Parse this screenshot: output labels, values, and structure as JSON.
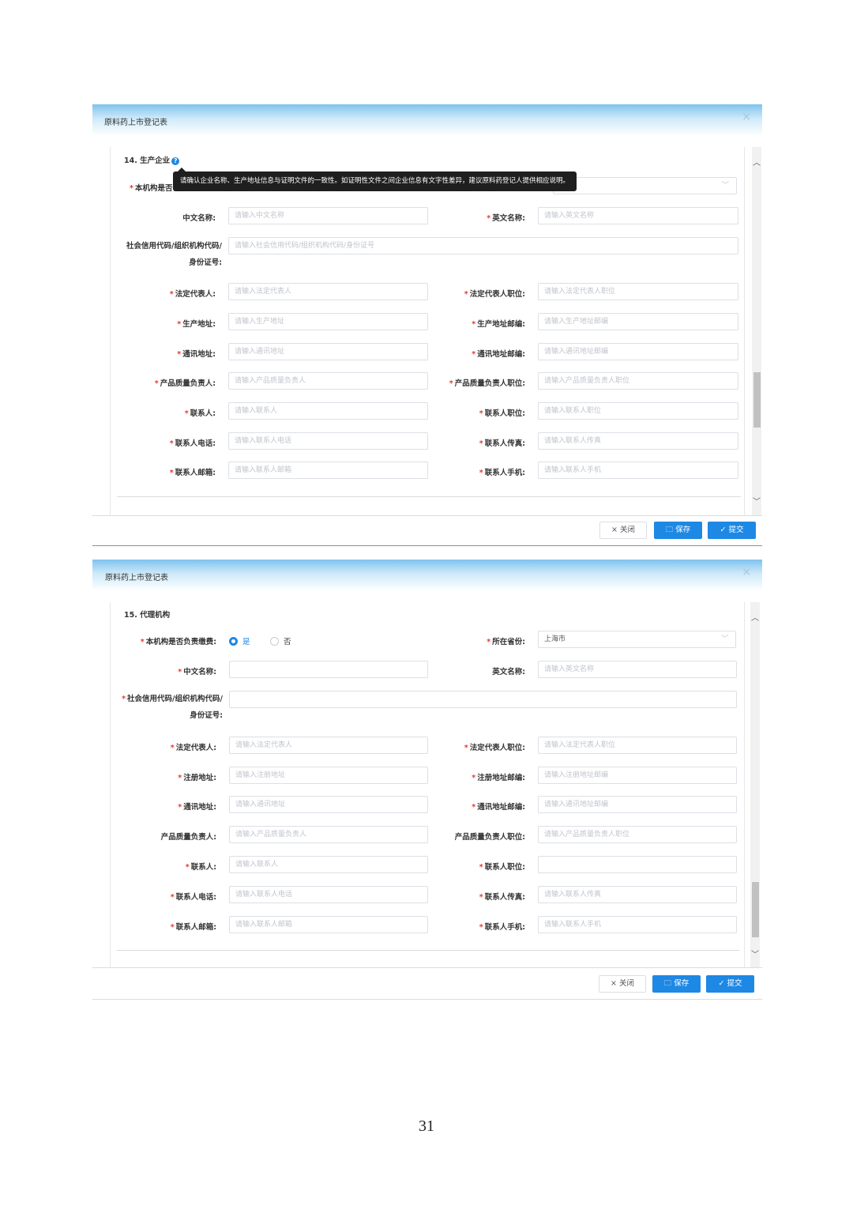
{
  "dialog1": {
    "title": "原料药上市登记表",
    "close": "×",
    "section": "14. 生产企业",
    "help": "?",
    "tooltip": "请确认企业名称、生产地址信息与证明文件的一致性。如证明性文件之间企业信息有文字性差异，建议原料药登记人提供相应说明。",
    "hidden_label": "本机构是否",
    "fields": {
      "cn_name_label": "中文名称:",
      "cn_name_ph": "请输入中文名称",
      "en_name_label": "英文名称:",
      "en_name_ph": "请输入英文名称",
      "credit_label": "社会信用代码/组织机构代码/身份证号:",
      "credit_ph": "请输入社会信用代码/组织机构代码/身份证号",
      "legal_label": "法定代表人:",
      "legal_ph": "请输入法定代表人",
      "legal_pos_label": "法定代表人职位:",
      "legal_pos_ph": "请输入法定代表人职位",
      "prod_addr_label": "生产地址:",
      "prod_addr_ph": "请输入生产地址",
      "prod_zip_label": "生产地址邮编:",
      "prod_zip_ph": "请输入生产地址邮编",
      "mail_addr_label": "通讯地址:",
      "mail_addr_ph": "请输入通讯地址",
      "mail_zip_label": "通讯地址邮编:",
      "mail_zip_ph": "请输入通讯地址邮编",
      "qa_label": "产品质量负责人:",
      "qa_ph": "请输入产品质量负责人",
      "qa_pos_label": "产品质量负责人职位:",
      "qa_pos_ph": "请输入产品质量负责人职位",
      "contact_label": "联系人:",
      "contact_ph": "请输入联系人",
      "contact_pos_label": "联系人职位:",
      "contact_pos_ph": "请输入联系人职位",
      "phone_label": "联系人电话:",
      "phone_ph": "请输入联系人电话",
      "fax_label": "联系人传真:",
      "fax_ph": "请输入联系人传真",
      "email_label": "联系人邮箱:",
      "email_ph": "请输入联系人邮箱",
      "mobile_label": "联系人手机:",
      "mobile_ph": "请输入联系人手机"
    },
    "buttons": {
      "close": "× 关闭",
      "save": "🗀 保存",
      "submit": "✓ 提交"
    }
  },
  "dialog2": {
    "title": "原料药上市登记表",
    "close": "×",
    "section": "15. 代理机构",
    "fields": {
      "payer_label": "本机构是否负责缴费:",
      "yes": "是",
      "no": "否",
      "province_label": "所在省份:",
      "province_value": "上海市",
      "cn_name_label": "中文名称:",
      "en_name_label": "英文名称:",
      "en_name_ph": "请输入英文名称",
      "credit_label": "社会信用代码/组织机构代码/身份证号:",
      "legal_label": "法定代表人:",
      "legal_ph": "请输入法定代表人",
      "legal_pos_label": "法定代表人职位:",
      "legal_pos_ph": "请输入法定代表人职位",
      "reg_addr_label": "注册地址:",
      "reg_addr_ph": "请输入注册地址",
      "reg_zip_label": "注册地址邮编:",
      "reg_zip_ph": "请输入注册地址邮编",
      "mail_addr_label": "通讯地址:",
      "mail_addr_ph": "请输入通讯地址",
      "mail_zip_label": "通讯地址邮编:",
      "mail_zip_ph": "请输入通讯地址邮编",
      "qa_label": "产品质量负责人:",
      "qa_ph": "请输入产品质量负责人",
      "qa_pos_label": "产品质量负责人职位:",
      "qa_pos_ph": "请输入产品质量负责人职位",
      "contact_label": "联系人:",
      "contact_ph": "请输入联系人",
      "contact_pos_label": "联系人职位:",
      "phone_label": "联系人电话:",
      "phone_ph": "请输入联系人电话",
      "fax_label": "联系人传真:",
      "fax_ph": "请输入联系人传真",
      "email_label": "联系人邮箱:",
      "email_ph": "请输入联系人邮箱",
      "mobile_label": "联系人手机:",
      "mobile_ph": "请输入联系人手机"
    },
    "buttons": {
      "close": "× 关闭",
      "save": "🗀 保存",
      "submit": "✓ 提交"
    }
  },
  "page_number": "31"
}
